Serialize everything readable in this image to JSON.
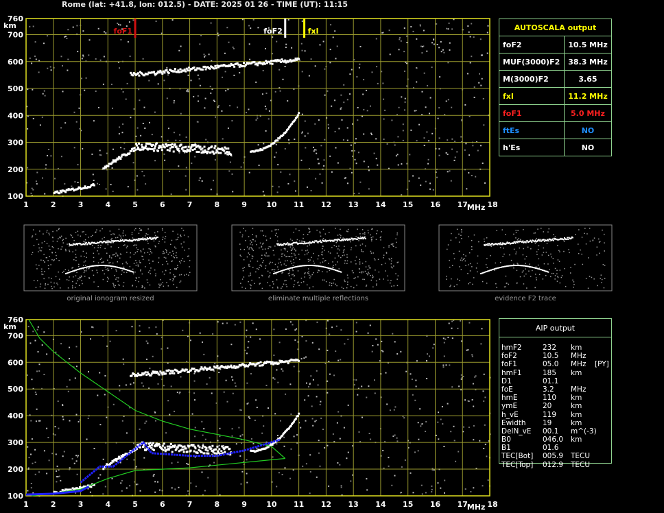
{
  "header": {
    "title": "Rome (lat: +41.8, lon: 012.5) - DATE: 2025 01 26 - TIME (UT): 11:15"
  },
  "colors": {
    "grid": "#9a9a2e",
    "frame": "#e0e020",
    "foF1": "#d01010",
    "fxI": "#ffff00",
    "ftEs": "#1e8fff",
    "trace": "#2020ff",
    "profile": "#22cc22"
  },
  "chart_data": [
    {
      "type": "scatter",
      "name": "ionogram",
      "xlabel": "MHz",
      "ylabel": "km",
      "xlim": [
        1,
        18
      ],
      "ylim": [
        100,
        760
      ],
      "x_ticks": [
        "1",
        "2",
        "3",
        "4",
        "5",
        "6",
        "7",
        "8",
        "9",
        "10",
        "11",
        "12",
        "13",
        "14",
        "15",
        "16",
        "17",
        "18"
      ],
      "y_ticks": [
        "100",
        "200",
        "300",
        "400",
        "500",
        "600",
        "700",
        "760"
      ],
      "grid": true,
      "markers": [
        {
          "label": "foF1",
          "x": 5.0,
          "color": "#d01010"
        },
        {
          "label": "foF2",
          "x": 10.5,
          "color": "#ffffff"
        },
        {
          "label": "fxI",
          "x": 11.2,
          "color": "#ffff00"
        }
      ]
    },
    {
      "type": "line",
      "name": "aip-profile",
      "xlabel": "MHz",
      "ylabel": "km",
      "xlim": [
        1,
        18
      ],
      "ylim": [
        100,
        760
      ],
      "x_ticks": [
        "1",
        "2",
        "3",
        "4",
        "5",
        "6",
        "7",
        "8",
        "9",
        "10",
        "11",
        "12",
        "13",
        "14",
        "15",
        "16",
        "17",
        "18"
      ],
      "y_ticks": [
        "100",
        "200",
        "300",
        "400",
        "500",
        "600",
        "700",
        "760"
      ],
      "grid": true
    }
  ],
  "thumbnails": [
    {
      "caption": "original ionogram resized"
    },
    {
      "caption": "eliminate multiple reflections"
    },
    {
      "caption": "evidence F2 trace"
    }
  ],
  "autoscala": {
    "title": "AUTOSCALA output",
    "rows": [
      {
        "label": "foF2",
        "value": "10.5 MHz",
        "color": "#ffffff"
      },
      {
        "label": "MUF(3000)F2",
        "value": "38.3 MHz",
        "color": "#ffffff"
      },
      {
        "label": "M(3000)F2",
        "value": "3.65",
        "color": "#ffffff"
      },
      {
        "label": "fxI",
        "value": "11.2 MHz",
        "color": "#ffff00"
      },
      {
        "label": "foF1",
        "value": "5.0 MHz",
        "color": "#ff2020"
      },
      {
        "label": "ftEs",
        "value": "NO",
        "color": "#1e8fff"
      },
      {
        "label": "h'Es",
        "value": "NO",
        "color": "#ffffff"
      }
    ]
  },
  "aip": {
    "title": "AIP output",
    "rows": [
      {
        "label": "hmF2",
        "value": "232",
        "unit": "km",
        "extra": ""
      },
      {
        "label": "foF2",
        "value": "10.5",
        "unit": "MHz",
        "extra": ""
      },
      {
        "label": "foF1",
        "value": "05.0",
        "unit": "MHz",
        "extra": "[PY]"
      },
      {
        "label": "hmF1",
        "value": "185",
        "unit": "km",
        "extra": ""
      },
      {
        "label": "D1",
        "value": "01.1",
        "unit": "",
        "extra": ""
      },
      {
        "label": "foE",
        "value": "3.2",
        "unit": "MHz",
        "extra": ""
      },
      {
        "label": "hmE",
        "value": "110",
        "unit": "km",
        "extra": ""
      },
      {
        "label": "ymE",
        "value": "20",
        "unit": "km",
        "extra": ""
      },
      {
        "label": "h_vE",
        "value": "119",
        "unit": "km",
        "extra": ""
      },
      {
        "label": "Ewidth",
        "value": "19",
        "unit": "km",
        "extra": ""
      },
      {
        "label": "DelN_vE",
        "value": "00.1",
        "unit": "m^(-3)",
        "extra": ""
      },
      {
        "label": "B0",
        "value": "046.0",
        "unit": "km",
        "extra": ""
      },
      {
        "label": "B1",
        "value": "01.6",
        "unit": "",
        "extra": ""
      },
      {
        "label": "TEC[Bot]",
        "value": "005.9",
        "unit": "TECU",
        "extra": ""
      },
      {
        "label": "TEC[Top]",
        "value": "012.9",
        "unit": "TECU",
        "extra": ""
      }
    ]
  }
}
